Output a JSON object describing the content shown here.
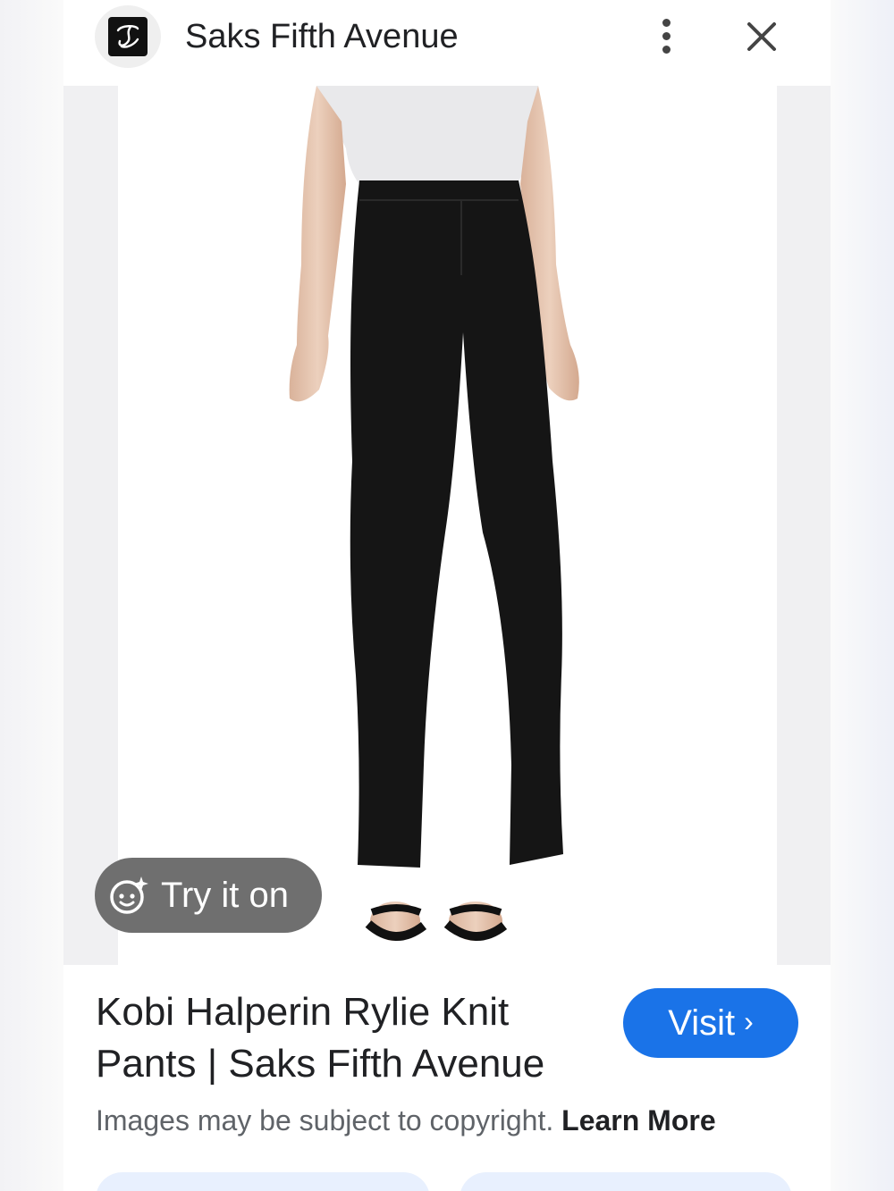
{
  "header": {
    "site_name": "Saks Fifth Avenue",
    "logo_icon": "saks-logo-icon",
    "menu_icon": "more-vert-icon",
    "close_icon": "close-icon"
  },
  "image": {
    "try_on_label": "Try it on",
    "try_on_icon": "sparkle-face-icon"
  },
  "result": {
    "title_line1": "Kobi Halperin Rylie Knit",
    "title_line2": "Pants | Saks Fifth Avenue",
    "visit_label": "Visit",
    "visit_icon": "chevron-right-icon",
    "copyright_text": "Images may be subject to copyright.",
    "learn_more": "Learn More"
  },
  "colors": {
    "accent": "#1a73e8",
    "try_on_bg": "#6f6f6f"
  }
}
